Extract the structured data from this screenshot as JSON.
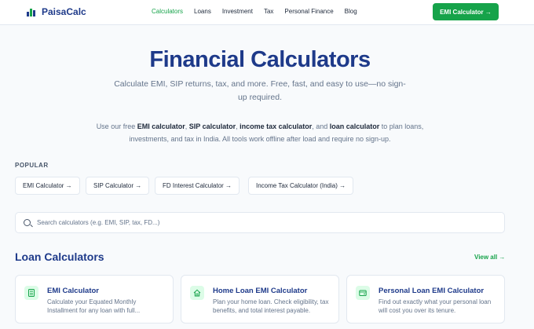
{
  "header": {
    "brand": "PaisaCalc",
    "nav": [
      "Calculators",
      "Loans",
      "Investment",
      "Tax",
      "Personal Finance",
      "Blog"
    ],
    "active_nav": "Calculators",
    "cta_label": "EMI Calculator →"
  },
  "hero": {
    "title": "Financial Calculators",
    "subtitle": "Calculate EMI, SIP returns, tax, and more. Free, fast, and easy to use—no sign-up required.",
    "intro_parts": [
      "Use our free ",
      "EMI calculator",
      ", ",
      "SIP calculator",
      ", ",
      "income tax calculator",
      ", and ",
      "loan calculator",
      " to plan loans, investments, and tax in India. All tools work offline after load and require no sign-up."
    ]
  },
  "popular": {
    "label": "POPULAR",
    "items": [
      "EMI Calculator →",
      "SIP Calculator →",
      "FD Interest Calculator →",
      "Income Tax Calculator (India) →"
    ]
  },
  "search": {
    "placeholder": "Search calculators (e.g. EMI, SIP, tax, FD...)",
    "value": ""
  },
  "loan_section": {
    "title": "Loan Calculators",
    "view_all": "View all →",
    "cards": [
      {
        "title": "EMI Calculator",
        "desc": "Calculate your Equated Monthly Installment for any loan with full...",
        "icon": "calculator-icon"
      },
      {
        "title": "Home Loan EMI Calculator",
        "desc": "Plan your home loan. Check eligibility, tax benefits, and total interest payable.",
        "icon": "home-icon"
      },
      {
        "title": "Personal Loan EMI Calculator",
        "desc": "Find out exactly what your personal loan will cost you over its tenure.",
        "icon": "wallet-icon"
      }
    ]
  },
  "colors": {
    "brand_navy": "#1e3a8a",
    "accent_green": "#16a34a",
    "icon_bg": "#dcfce7",
    "page_bg": "#f8fafc"
  }
}
